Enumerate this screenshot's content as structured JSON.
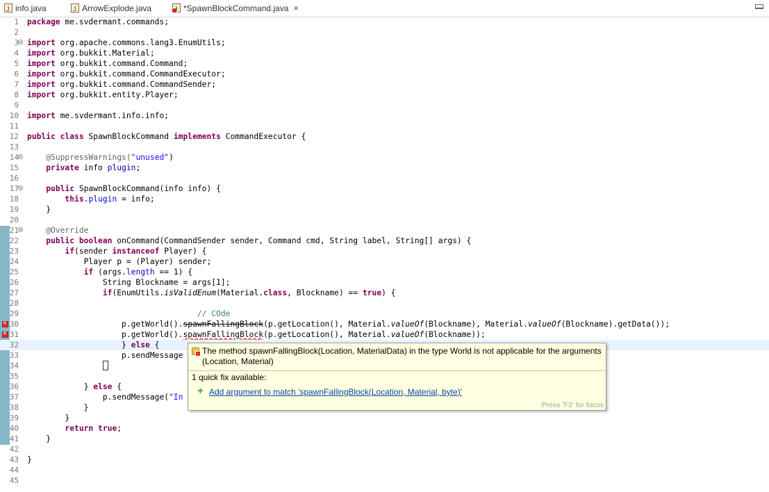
{
  "tabs": [
    {
      "label": "info.java",
      "active": false,
      "error": false
    },
    {
      "label": "ArrowExplode.java",
      "active": false,
      "error": false
    },
    {
      "label": "*SpawnBlockCommand.java",
      "active": true,
      "error": true,
      "close": "×"
    }
  ],
  "editor": {
    "line_numbers": [
      "1",
      "2",
      "3",
      "4",
      "5",
      "6",
      "7",
      "8",
      "9",
      "10",
      "11",
      "12",
      "13",
      "14",
      "15",
      "16",
      "17",
      "18",
      "19",
      "20",
      "21",
      "22",
      "23",
      "24",
      "25",
      "26",
      "27",
      "28",
      "29",
      "30",
      "31",
      "32",
      "33",
      "34",
      "35",
      "36",
      "37",
      "38",
      "39",
      "40",
      "41",
      "42",
      "43",
      "44",
      "45"
    ],
    "current_line": "32",
    "error_lines": [
      "30",
      "31"
    ],
    "fold_lines": [
      "3",
      "14",
      "17",
      "21"
    ]
  },
  "code": {
    "l1": "package me.svdermant.commands;",
    "l3a": "import",
    "l3b": " org.apache.commons.lang3.EnumUtils;",
    "l4a": "import",
    "l4b": " org.bukkit.Material;",
    "l5a": "import",
    "l5b": " org.bukkit.command.Command;",
    "l6a": "import",
    "l6b": " org.bukkit.command.CommandExecutor;",
    "l7a": "import",
    "l7b": " org.bukkit.command.CommandSender;",
    "l8a": "import",
    "l8b": " org.bukkit.entity.Player;",
    "l10a": "import",
    "l10b": " me.svdermant.info.info;",
    "l12a": "public class",
    "l12b": " SpawnBlockCommand ",
    "l12c": "implements",
    "l12d": " CommandExecutor {",
    "l14a": "@SuppressWarnings(",
    "l14b": "\"unused\"",
    "l14c": ")",
    "l15a": "private",
    "l15b": " info ",
    "l15c": "plugin",
    "l15d": ";",
    "l17a": "public",
    "l17b": " SpawnBlockCommand(info info) {",
    "l18a": "this",
    "l18b": ".",
    "l18c": "plugin",
    "l18d": " = info;",
    "l19": "}",
    "l21": "@Override",
    "l22a": "public boolean",
    "l22b": " onCommand(CommandSender sender, Command cmd, String label, String[] args) {",
    "l23a": "if",
    "l23b": "(sender ",
    "l23c": "instanceof",
    "l23d": " Player) {",
    "l24": "Player p = (Player) sender;",
    "l25a": "if",
    "l25b": " (args.",
    "l25c": "length",
    "l25d": " == 1) {",
    "l26": "String Blockname = args[1];",
    "l27a": "if",
    "l27b": "(EnumUtils.",
    "l27c": "isValidEnum",
    "l27d": "(Material.",
    "l27e": "class",
    "l27f": ", Blockname) == ",
    "l27g": "true",
    "l27h": ") {",
    "l29": "// COde",
    "l30a": "p.getWorld().",
    "l30b": "spawnFallingBlock",
    "l30c": "(p.getLocation(), Material.",
    "l30d": "valueOf",
    "l30e": "(Blockname), Material.",
    "l30f": "valueOf",
    "l30g": "(Blockname).getData());",
    "l31a": "p.getWorld().",
    "l31b": "spawnFallingBlock",
    "l31c": "(p.getLocation(), Material.",
    "l31d": "valueOf",
    "l31e": "(Blockname));",
    "l32a": "} ",
    "l32b": "else",
    "l32c": " {",
    "l33": "p.sendMessage",
    "l36a": "} ",
    "l36b": "else",
    "l36c": " {",
    "l37a": "p.sendMessage(",
    "l37b": "\"In",
    "l38": "}",
    "l39": "}",
    "l40a": "return",
    "l40b": " ",
    "l40c": "true",
    "l40d": ";",
    "l41": "}",
    "l43": "}"
  },
  "tooltip": {
    "message": "The method spawnFallingBlock(Location, MaterialData) in the type World is not applicable for the arguments (Location, Material)",
    "quick_fix_count": "1 quick fix available:",
    "quick_fix": "Add argument to match 'spawnFallingBlock(Location, Material, byte)'",
    "hint": "Press 'F2' for focus"
  },
  "colors": {
    "keyword": "#7f0055",
    "string": "#2a00ff",
    "field": "#0000c0",
    "comment": "#3f7f5f",
    "error": "#d9302c",
    "tooltip_bg": "#ffffe1",
    "current_line": "#e8f2fe"
  }
}
